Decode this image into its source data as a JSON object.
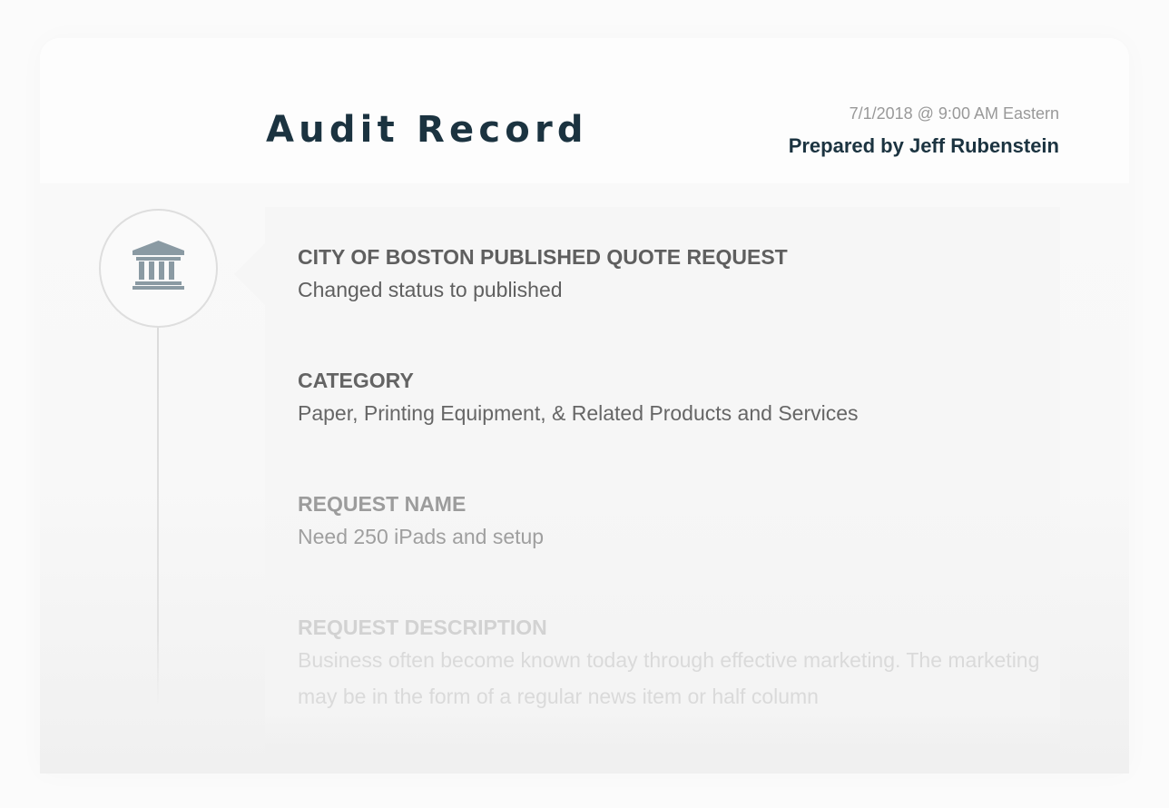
{
  "header": {
    "title": "Audit Record",
    "timestamp": "7/1/2018 @ 9:00 AM Eastern",
    "prepared_by": "Prepared by Jeff Rubenstein"
  },
  "timeline": {
    "icon": "bank-building-icon",
    "icon_color": "#8a9aa3"
  },
  "entry": {
    "fields": [
      {
        "label": "CITY OF BOSTON PUBLISHED QUOTE REQUEST",
        "value": "Changed status to published"
      },
      {
        "label": "CATEGORY",
        "value": "Paper, Printing Equipment, & Related Products and Services"
      },
      {
        "label": "REQUEST NAME",
        "value": "Need 250 iPads and setup"
      },
      {
        "label": "REQUEST DESCRIPTION",
        "value": "Business often become known today through effective marketing. The marketing may be in the form of a regular news item or half column"
      }
    ]
  },
  "colors": {
    "title": "#1b3340",
    "muted": "#999999",
    "panel": "#f6f6f6"
  }
}
